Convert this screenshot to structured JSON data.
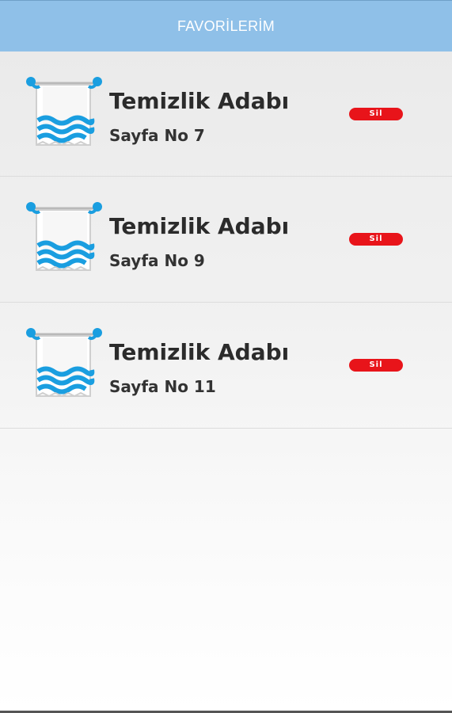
{
  "header": {
    "title": "FAVORİLERİM"
  },
  "favorites": [
    {
      "title": "Temizlik Adabı",
      "page": "Sayfa No 7",
      "delete_label": "Sil"
    },
    {
      "title": "Temizlik Adabı",
      "page": "Sayfa No 9",
      "delete_label": "Sil"
    },
    {
      "title": "Temizlik Adabı",
      "page": "Sayfa No 11",
      "delete_label": "Sil"
    }
  ],
  "colors": {
    "header_bg": "#8fc0e8",
    "delete_bg": "#e8141a",
    "icon_blue": "#1a9ee0"
  },
  "icons": {
    "favorite_item": "towel-icon"
  }
}
